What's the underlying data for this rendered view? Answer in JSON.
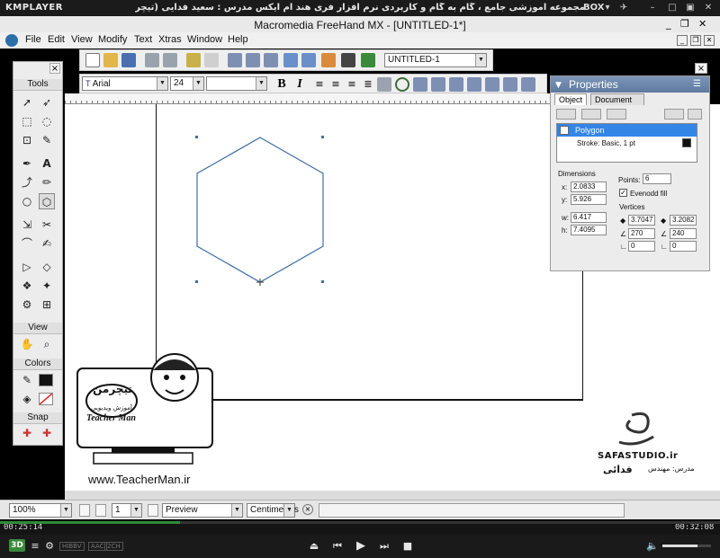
{
  "kmplayer": {
    "logo": "KMPLAYER",
    "title": "مجموعه آموزشی جامع ، گام به گام و کاربردی نرم افزار فری هند ام ایکس  مدرس : سعید فدایی (تیچرمن) گروه آموزشی پادشاه گرافیست ها",
    "box_label": "BOX",
    "time_current": "00:25:14",
    "time_total": "00:32:08",
    "badges": [
      "3D",
      "HIBBV",
      "AAC",
      "2CH"
    ],
    "seek_progress": 0.25,
    "volume_level": 0.72
  },
  "window": {
    "title": "Macromedia FreeHand MX - [UNTITLED-1*]"
  },
  "menu": [
    "File",
    "Edit",
    "View",
    "Modify",
    "Text",
    "Xtras",
    "Window",
    "Help"
  ],
  "toolbar": {
    "document_select": "UNTITLED-1",
    "font_name": "Arial",
    "font_size": "24",
    "style_value": "",
    "leading_value": ""
  },
  "tools_panel": {
    "title": "Tools",
    "close": "×",
    "sections": {
      "view": "View",
      "colors": "Colors",
      "snap": "Snap"
    }
  },
  "properties": {
    "title": "Properties",
    "tabs": [
      "Object",
      "Document"
    ],
    "object_items": [
      "Polygon",
      "Stroke: Basic, 1 pt"
    ],
    "dimensions_label": "Dimensions",
    "x_label": "x:",
    "x": "2.0833",
    "y_label": "y:",
    "y": "5.926",
    "w_label": "w:",
    "w": "6.417",
    "h_label": "h:",
    "h": "7.4095",
    "points_label": "Points:",
    "points": "6",
    "evenodd_label": "Evenodd fill",
    "vertices_label": "Vertices",
    "v1": "3.7047",
    "v2": "3.2082",
    "a1": "270",
    "a2": "240",
    "r1": "0",
    "r2": "0"
  },
  "status": {
    "zoom": "100%",
    "page": "1",
    "mode": "Preview",
    "units": "Centimeters"
  },
  "watermark": {
    "logo_text_fa": "تیچرمن",
    "logo_subtitle_fa": "آموزش ویدیویی",
    "name_en": "Teacher Man",
    "url": "www.TeacherMan.ir",
    "studio": "SAFASTUDIO.ir",
    "teacher_label": "مدرس: مهندس",
    "teacher_name": "فدائی"
  },
  "colors": {
    "accent": "#3385e6",
    "polygon_stroke": "#3f6fa3",
    "seek_fill": "#2e8b3a"
  }
}
